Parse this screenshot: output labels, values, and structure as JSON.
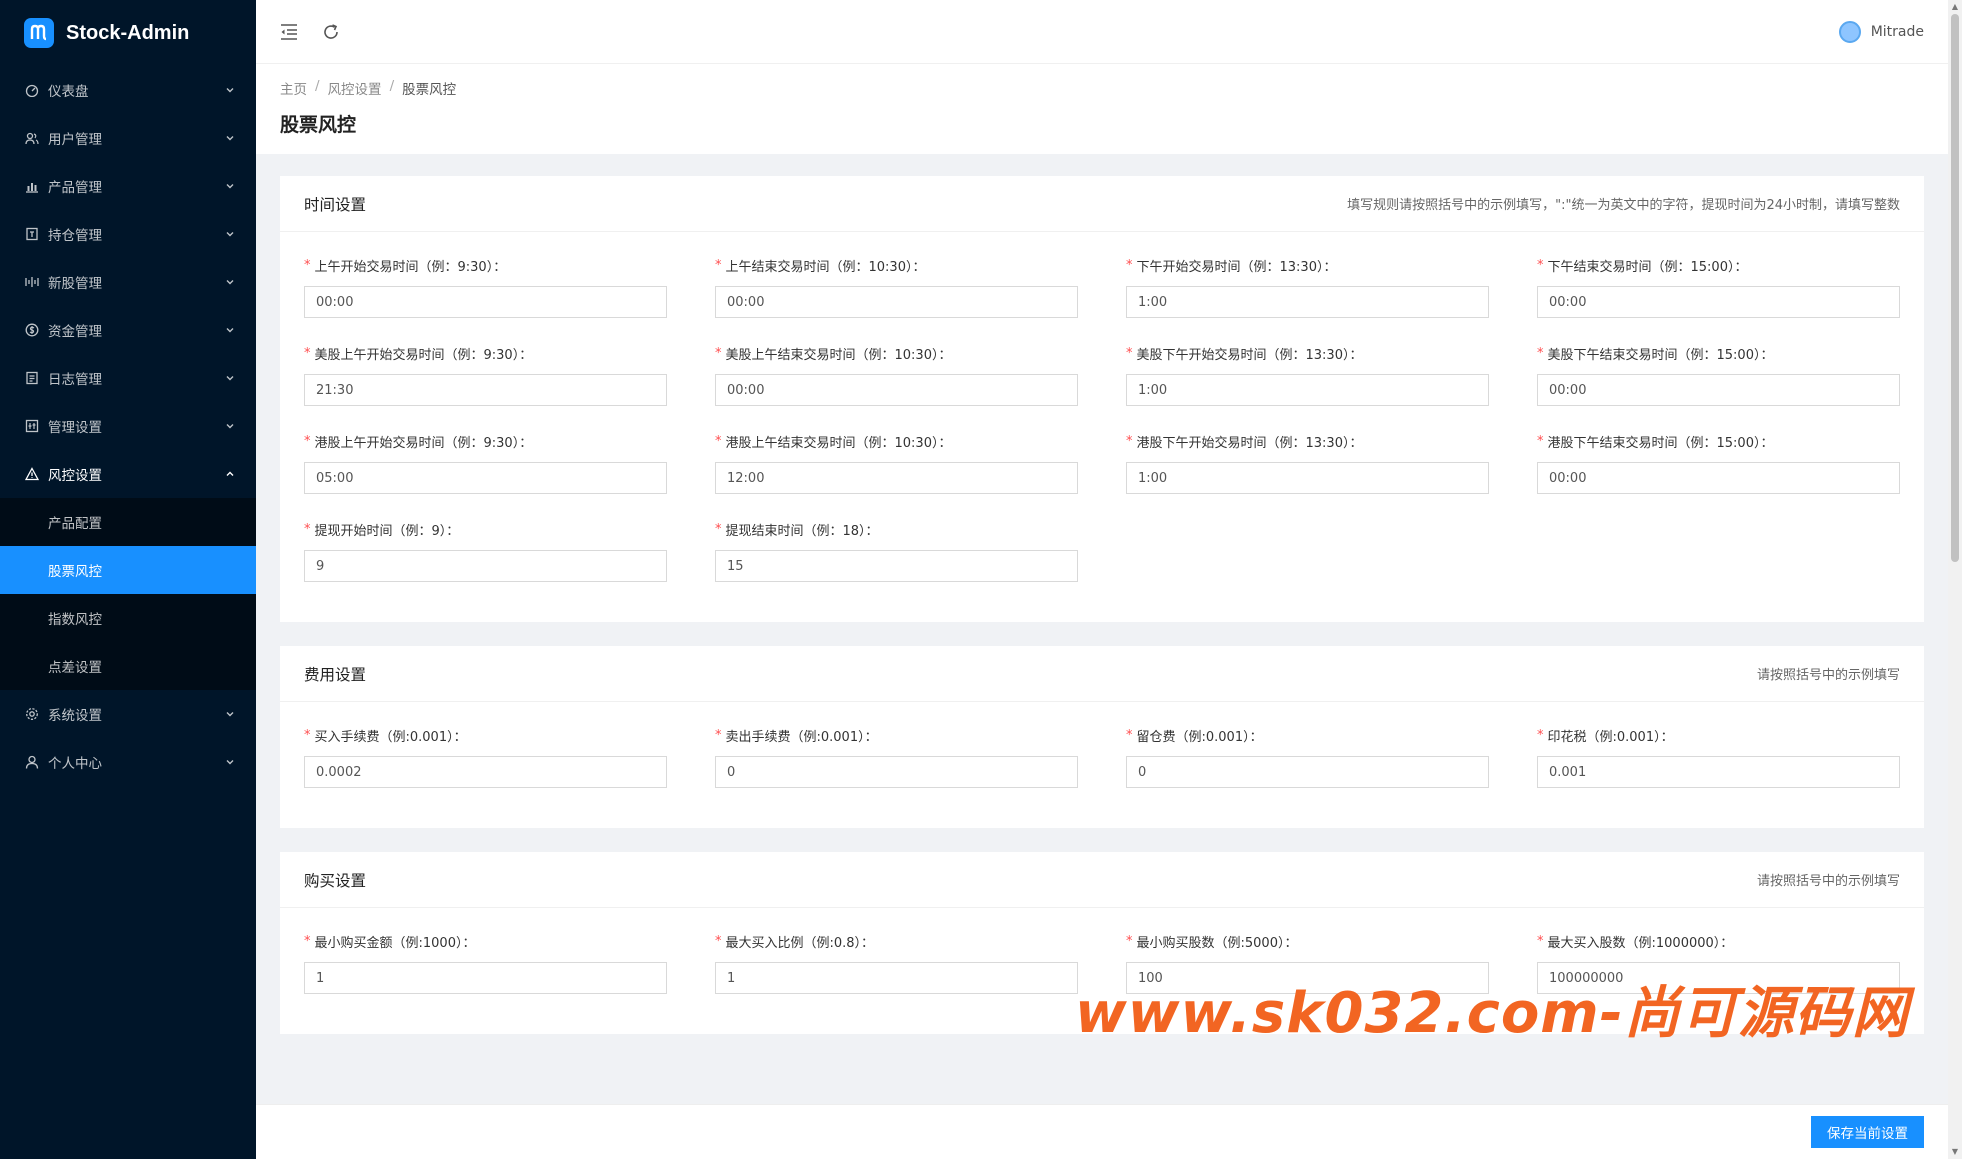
{
  "app": {
    "title": "Stock-Admin"
  },
  "sidebar": {
    "items": [
      {
        "label": "仪表盘",
        "icon": "dashboard-icon"
      },
      {
        "label": "用户管理",
        "icon": "user-group-icon"
      },
      {
        "label": "产品管理",
        "icon": "bar-chart-icon"
      },
      {
        "label": "持仓管理",
        "icon": "portfolio-icon"
      },
      {
        "label": "新股管理",
        "icon": "new-stock-icon"
      },
      {
        "label": "资金管理",
        "icon": "money-icon"
      },
      {
        "label": "日志管理",
        "icon": "log-icon"
      },
      {
        "label": "管理设置",
        "icon": "manage-icon"
      },
      {
        "label": "风控设置",
        "icon": "warning-icon"
      },
      {
        "label": "系统设置",
        "icon": "gear-icon"
      },
      {
        "label": "个人中心",
        "icon": "person-icon"
      }
    ],
    "submenu": [
      {
        "label": "产品配置"
      },
      {
        "label": "股票风控"
      },
      {
        "label": "指数风控"
      },
      {
        "label": "点差设置"
      }
    ]
  },
  "header": {
    "username": "Mitrade"
  },
  "breadcrumb": {
    "home": "主页",
    "parent": "风控设置",
    "current": "股票风控"
  },
  "page": {
    "title": "股票风控"
  },
  "sections": {
    "time": {
      "title": "时间设置",
      "hint": "填写规则请按照括号中的示例填写，\":\"统一为英文中的字符，提现时间为24小时制，请填写整数",
      "fields": [
        {
          "label": "上午开始交易时间（例：9:30）：",
          "value": "00:00"
        },
        {
          "label": "上午结束交易时间（例：10:30）：",
          "value": "00:00"
        },
        {
          "label": "下午开始交易时间（例：13:30）：",
          "value": "1:00"
        },
        {
          "label": "下午结束交易时间（例：15:00）：",
          "value": "00:00"
        },
        {
          "label": "美股上午开始交易时间（例：9:30）：",
          "value": "21:30"
        },
        {
          "label": "美股上午结束交易时间（例：10:30）：",
          "value": "00:00"
        },
        {
          "label": "美股下午开始交易时间（例：13:30）：",
          "value": "1:00"
        },
        {
          "label": "美股下午结束交易时间（例：15:00）：",
          "value": "00:00"
        },
        {
          "label": "港股上午开始交易时间（例：9:30）：",
          "value": "05:00"
        },
        {
          "label": "港股上午结束交易时间（例：10:30）：",
          "value": "12:00"
        },
        {
          "label": "港股下午开始交易时间（例：13:30）：",
          "value": "1:00"
        },
        {
          "label": "港股下午结束交易时间（例：15:00）：",
          "value": "00:00"
        },
        {
          "label": "提现开始时间（例：9）：",
          "value": "9"
        },
        {
          "label": "提现结束时间（例：18）：",
          "value": "15"
        }
      ]
    },
    "fee": {
      "title": "费用设置",
      "hint": "请按照括号中的示例填写",
      "fields": [
        {
          "label": "买入手续费（例:0.001）：",
          "value": "0.0002"
        },
        {
          "label": "卖出手续费（例:0.001）：",
          "value": "0"
        },
        {
          "label": "留仓费（例:0.001）：",
          "value": "0"
        },
        {
          "label": "印花税（例:0.001）：",
          "value": "0.001"
        }
      ]
    },
    "buy": {
      "title": "购买设置",
      "hint": "请按照括号中的示例填写",
      "fields": [
        {
          "label": "最小购买金额（例:1000）：",
          "value": "1"
        },
        {
          "label": "最大买入比例（例:0.8）：",
          "value": "1"
        },
        {
          "label": "最小购买股数（例:5000）：",
          "value": "100"
        },
        {
          "label": "最大买入股数（例:1000000）：",
          "value": "100000000"
        }
      ]
    }
  },
  "footer": {
    "save_label": "保存当前设置"
  },
  "watermark": "www.sk032.com-尚可源码网",
  "colors": {
    "sidebar_bg": "#001529",
    "submenu_bg": "#000c17",
    "primary": "#1890ff",
    "required": "#ff4d4f",
    "watermark": "#f26522"
  }
}
